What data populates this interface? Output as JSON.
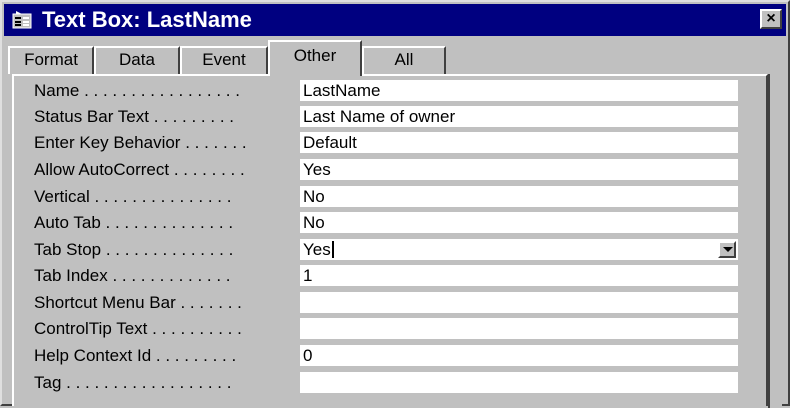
{
  "window": {
    "title": "Text Box: LastName",
    "close_symbol": "×",
    "colors": {
      "titlebar": "#000080",
      "face": "#c0c0c0"
    }
  },
  "tabs": [
    {
      "label": "Format",
      "active": false
    },
    {
      "label": "Data",
      "active": false
    },
    {
      "label": "Event",
      "active": false
    },
    {
      "label": "Other",
      "active": true
    },
    {
      "label": "All",
      "active": false
    }
  ],
  "properties": [
    {
      "label": "Name . . . . . . . . . . . . . . . . .",
      "value": "LastName"
    },
    {
      "label": "Status Bar Text . . . . . . . . .",
      "value": "Last Name of owner"
    },
    {
      "label": "Enter Key Behavior . . . . . . .",
      "value": "Default"
    },
    {
      "label": "Allow AutoCorrect . . . . . . . .",
      "value": "Yes"
    },
    {
      "label": "Vertical . . . . . . . . . . . . . . .",
      "value": "No"
    },
    {
      "label": "Auto Tab . . . . . . . . . . . . . .",
      "value": "No"
    },
    {
      "label": "Tab Stop . . . . . . . . . . . . . .",
      "value": "Yes"
    },
    {
      "label": "Tab Index . . . . . . . . . . . . .",
      "value": "1"
    },
    {
      "label": "Shortcut Menu Bar . . . . . . .",
      "value": ""
    },
    {
      "label": "ControlTip Text . . . . . . . . . .",
      "value": ""
    },
    {
      "label": "Help Context Id . . . . . . . . .",
      "value": "0"
    },
    {
      "label": "Tag . . . . . . . . . . . . . . . . . .",
      "value": ""
    }
  ],
  "icons": {
    "title": "properties-sheet-icon",
    "dropdown": "chevron-down-icon"
  }
}
